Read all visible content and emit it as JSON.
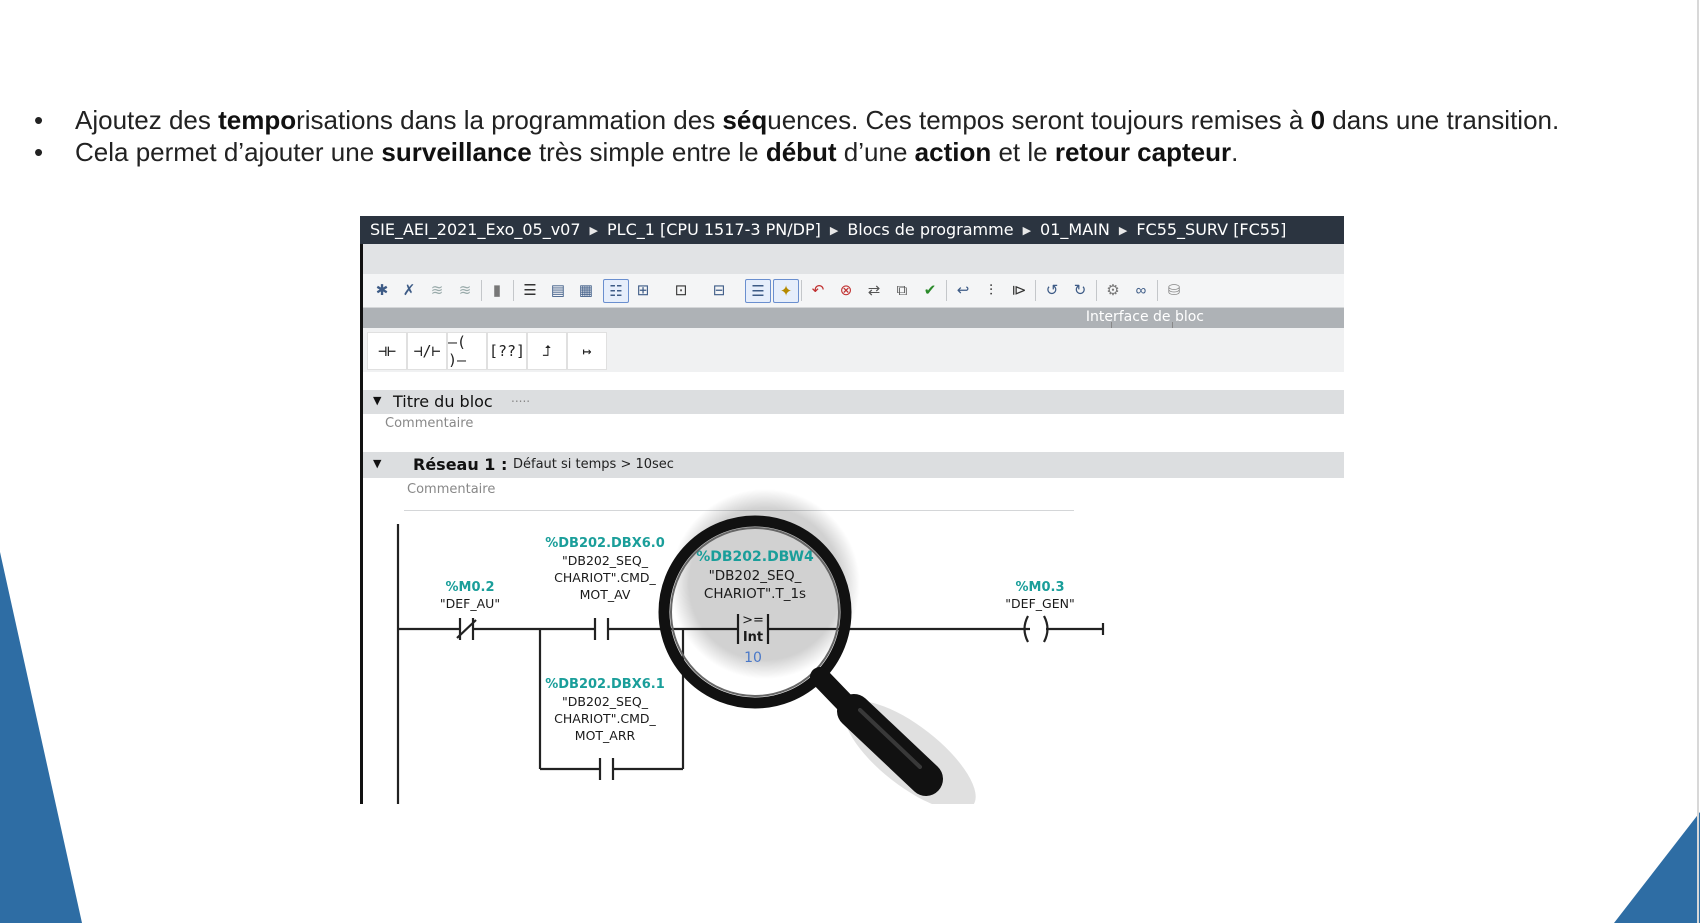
{
  "slide": {
    "bullets": [
      {
        "marker": "•",
        "parts": [
          {
            "text": "Ajoutez des ",
            "bold": false
          },
          {
            "text": "tempo",
            "bold": true
          },
          {
            "text": "risations dans la programmation des ",
            "bold": false
          },
          {
            "text": "séq",
            "bold": true
          },
          {
            "text": "uences. Ces tempos seront toujours remises à ",
            "bold": false
          },
          {
            "text": "0",
            "bold": true
          },
          {
            "text": " dans une transition.",
            "bold": false
          }
        ]
      },
      {
        "marker": "•",
        "parts": [
          {
            "text": "Cela permet d’ajouter une ",
            "bold": false
          },
          {
            "text": "surveillance",
            "bold": true
          },
          {
            "text": " très simple entre le ",
            "bold": false
          },
          {
            "text": "début",
            "bold": true
          },
          {
            "text": " d’une ",
            "bold": false
          },
          {
            "text": "action",
            "bold": true
          },
          {
            "text": " et le ",
            "bold": false
          },
          {
            "text": "retour capteur",
            "bold": true
          },
          {
            "text": ".",
            "bold": false
          }
        ]
      }
    ],
    "accent_color": "#2e6da4"
  },
  "screenshot": {
    "breadcrumb": [
      "SIE_AEI_2021_Exo_05_v07",
      "PLC_1 [CPU 1517-3 PN/DP]",
      "Blocs de programme",
      "01_MAIN",
      "FC55_SURV [FC55]"
    ],
    "breadcrumb_separator": "▶",
    "interface_label": "Interface de bloc",
    "ladder_tools": [
      "⊣⊢",
      "⊣/⊢",
      "–( )–",
      "[??]",
      "⮥",
      "↦"
    ],
    "block_title": {
      "label": "Titre du bloc",
      "dots": ".....",
      "comment": "Commentaire"
    },
    "network": {
      "label": "Réseau 1 :",
      "title": "Défaut si temps > 10sec",
      "comment": "Commentaire",
      "contacts": [
        {
          "address": "%M0.2",
          "lines": [
            "\"DEF_AU\""
          ]
        },
        {
          "address": "%DB202.DBX6.0",
          "lines": [
            "\"DB202_SEQ_",
            "CHARIOT\".CMD_",
            "MOT_AV"
          ]
        },
        {
          "address": "%DB202.DBX6.1",
          "lines": [
            "\"DB202_SEQ_",
            "CHARIOT\".CMD_",
            "MOT_ARR"
          ]
        },
        {
          "address": "%DB202.DBW4",
          "lines": [
            "\"DB202_SEQ_",
            "CHARIOT\".T_1s"
          ],
          "compare_op": ">=",
          "compare_type": "Int",
          "compare_value": "10"
        }
      ],
      "coil": {
        "address": "%M0.3",
        "lines": [
          "\"DEF_GEN\""
        ]
      }
    }
  }
}
